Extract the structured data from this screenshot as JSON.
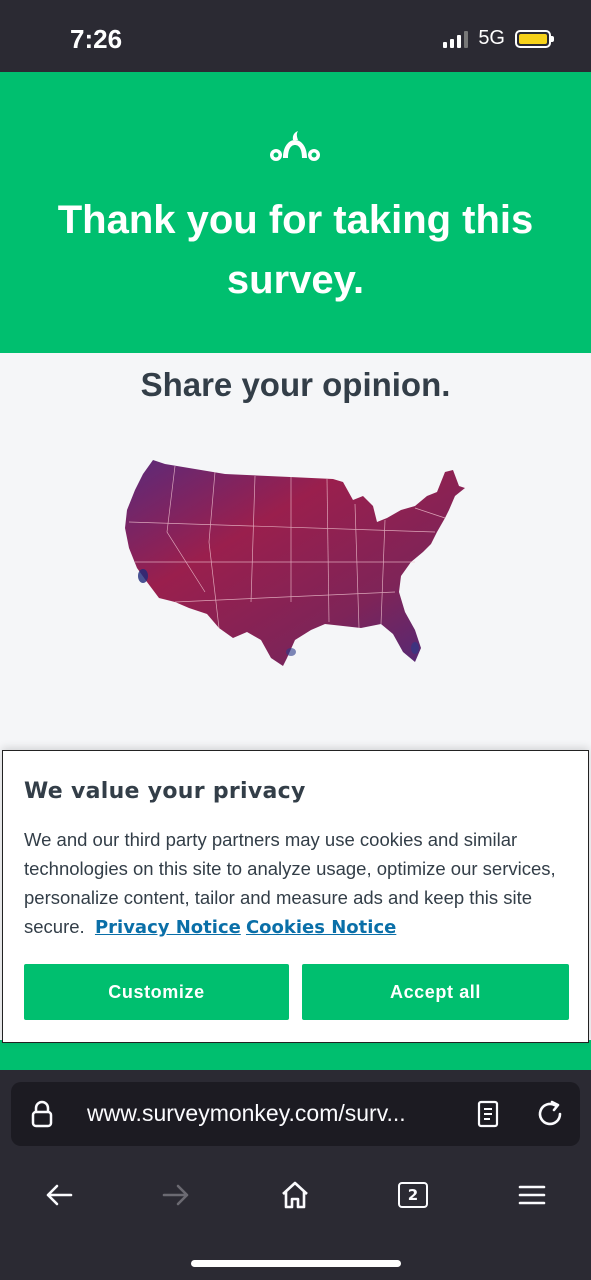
{
  "status_bar": {
    "time": "7:26",
    "network": "5G",
    "battery_level": 1.0,
    "battery_color": "#f7d21a"
  },
  "hero": {
    "title": "Thank you for taking this survey.",
    "logo_icon": "surveymonkey-logo-icon",
    "background_color": "#00bf6f"
  },
  "content": {
    "subheading": "Share your opinion.",
    "map_icon": "us-map-image"
  },
  "privacy_banner": {
    "title": "We value your privacy",
    "body": "We and our third party partners may use cookies and similar technologies on this site to analyze usage, optimize our services, personalize content, tailor and measure ads and keep this site secure.",
    "privacy_link": "Privacy Notice",
    "cookies_link": "Cookies Notice",
    "customize_label": "Customize",
    "accept_label": "Accept all",
    "link_color": "#0a6fa8",
    "button_color": "#00bf6f"
  },
  "browser": {
    "url": "www.surveymonkey.com/surv...",
    "tab_count": "2"
  }
}
